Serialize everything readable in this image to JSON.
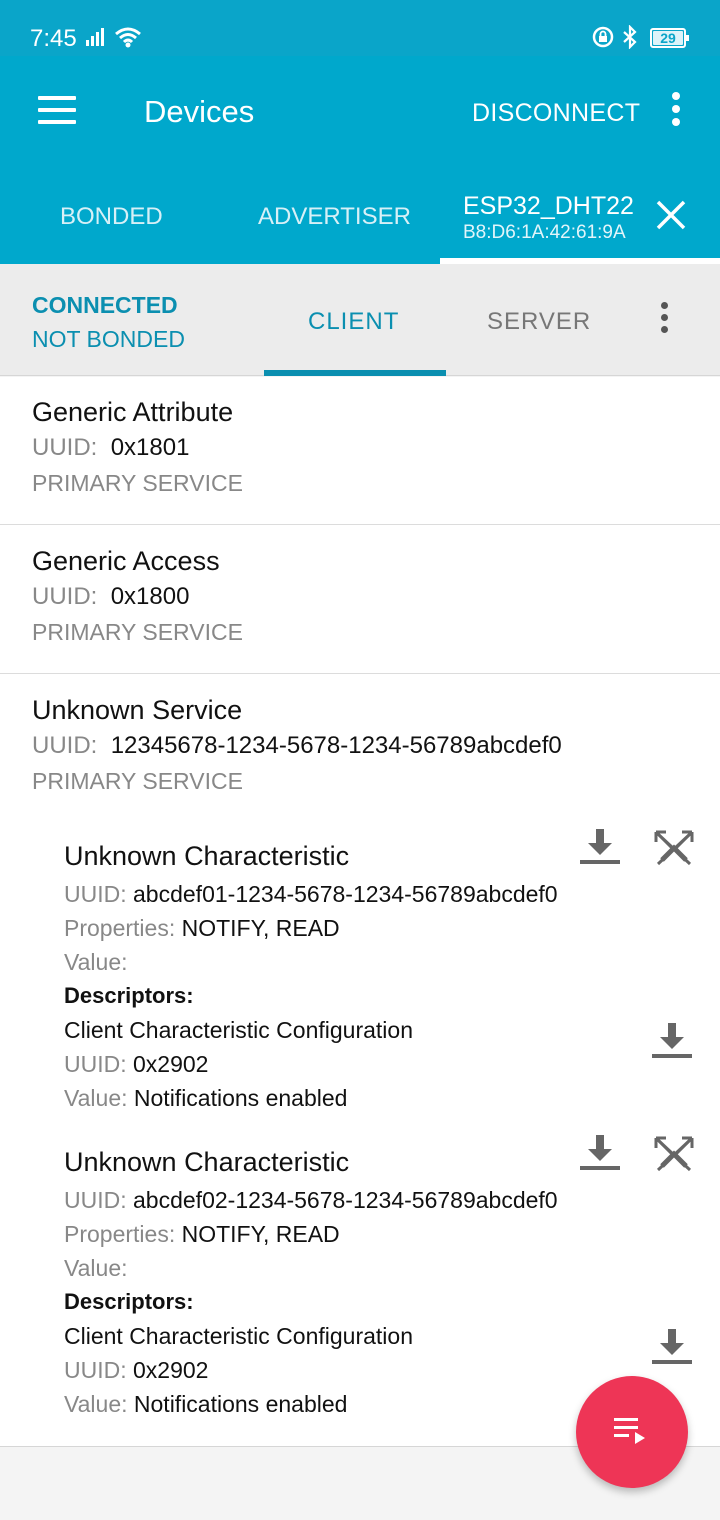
{
  "status_bar": {
    "time": "7:45",
    "battery": "29"
  },
  "app_bar": {
    "title": "Devices",
    "disconnect_label": "DISCONNECT",
    "tabs": {
      "bonded": "BONDED",
      "advertiser": "ADVERTISER",
      "device_name": "ESP32_DHT22",
      "device_mac": "B8:D6:1A:42:61:9A"
    }
  },
  "sub_bar": {
    "connection_state": "CONNECTED",
    "bond_state": "NOT BONDED",
    "tab_client": "CLIENT",
    "tab_server": "SERVER"
  },
  "labels": {
    "uuid": "UUID:",
    "properties": "Properties:",
    "value": "Value:",
    "descriptors": "Descriptors:"
  },
  "services": [
    {
      "name": "Generic Attribute",
      "uuid": "0x1801",
      "type": "PRIMARY SERVICE"
    },
    {
      "name": "Generic Access",
      "uuid": "0x1800",
      "type": "PRIMARY SERVICE"
    },
    {
      "name": "Unknown Service",
      "uuid": "12345678-1234-5678-1234-56789abcdef0",
      "type": "PRIMARY SERVICE",
      "characteristics": [
        {
          "name": "Unknown Characteristic",
          "uuid": "abcdef01-1234-5678-1234-56789abcdef0",
          "properties": "NOTIFY, READ",
          "value": "",
          "descriptor": {
            "name": "Client Characteristic Configuration",
            "uuid": "0x2902",
            "value": "Notifications enabled"
          }
        },
        {
          "name": "Unknown Characteristic",
          "uuid": "abcdef02-1234-5678-1234-56789abcdef0",
          "properties": "NOTIFY, READ",
          "value": "",
          "descriptor": {
            "name": "Client Characteristic Configuration",
            "uuid": "0x2902",
            "value": "Notifications enabled"
          }
        }
      ]
    }
  ],
  "icons": {
    "read": "download-icon",
    "notify": "notifications-disabled-icon",
    "fab": "log-list-icon"
  },
  "colors": {
    "app_bar": "#00a8cc",
    "status_bar": "#0aa5c9",
    "accent": "#0b8fb0",
    "fab": "#ee3556"
  }
}
